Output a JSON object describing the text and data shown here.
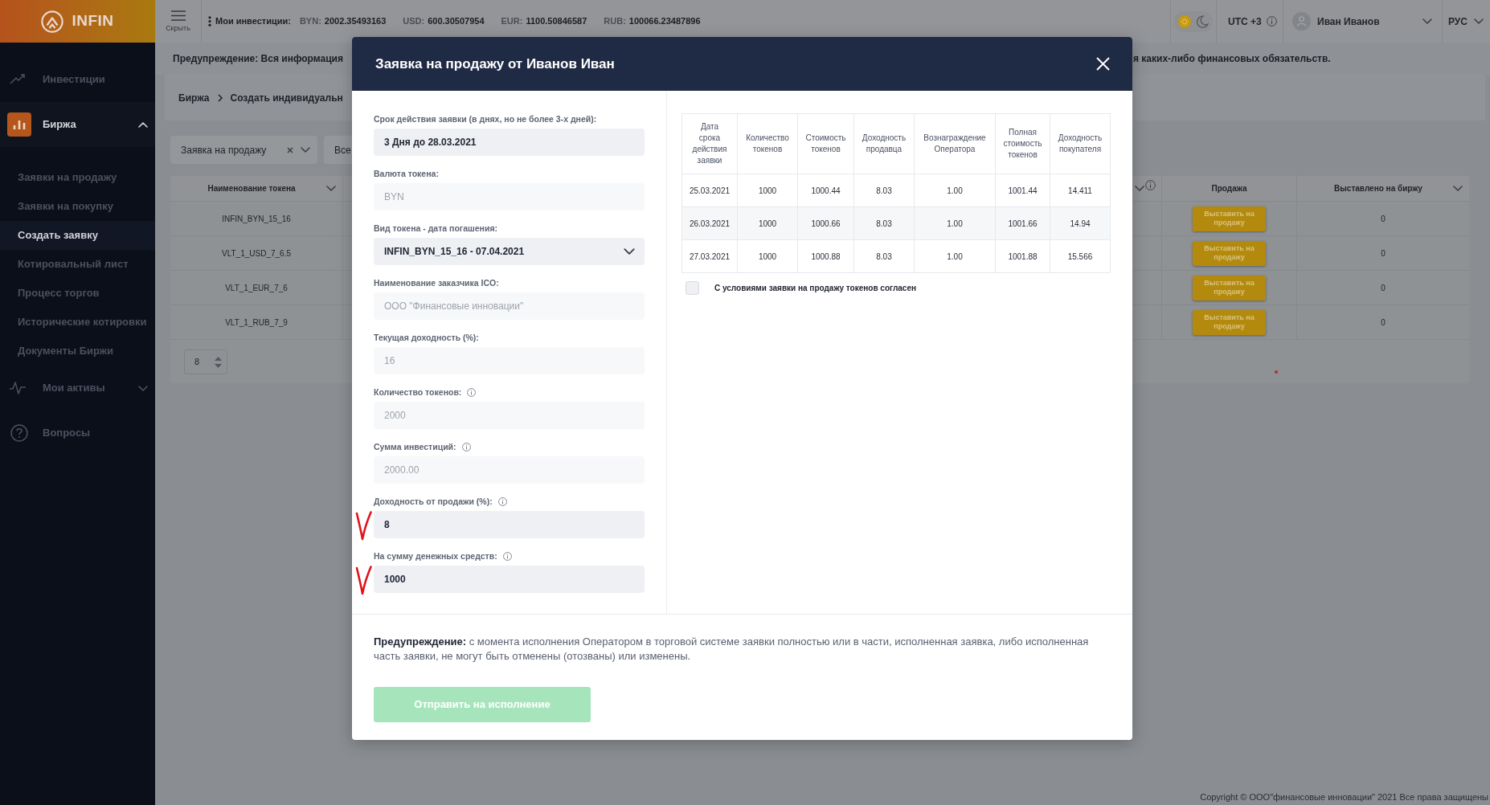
{
  "topbar": {
    "logo": "INFIN",
    "hide_label": "Скрыть",
    "investments_label": "Мои инвестиции:",
    "balances": [
      {
        "currency": "BYN:",
        "amount": "2002.35493163"
      },
      {
        "currency": "USD:",
        "amount": "600.30507954"
      },
      {
        "currency": "EUR:",
        "amount": "1100.50846587"
      },
      {
        "currency": "RUB:",
        "amount": "100066.23487896"
      }
    ],
    "dark_mode": false,
    "timezone": "UTC +3",
    "user": "Иван Иванов",
    "language": "РУС"
  },
  "sidebar": {
    "items": [
      {
        "label": "Инвестиции",
        "selected": false
      },
      {
        "label": "Биржа",
        "selected": true,
        "expanded": true,
        "children": [
          {
            "label": "Заявки на продажу",
            "selected": false
          },
          {
            "label": "Заявки на покупку",
            "selected": false
          },
          {
            "label": "Создать заявку",
            "selected": true
          },
          {
            "label": "Котировальный лист",
            "selected": false
          },
          {
            "label": "Процесс торгов",
            "selected": false
          },
          {
            "label": "Исторические котировки",
            "selected": false
          },
          {
            "label": "Документы Биржи",
            "selected": false
          }
        ]
      },
      {
        "label": "Мои активы",
        "selected": false,
        "expanded": false
      },
      {
        "label": "Вопросы",
        "selected": false
      }
    ]
  },
  "notice": {
    "text_start": "Предупреждение: Вся информация",
    "text_end": "я каких-либо финансовых обязательств."
  },
  "breadcrumb": [
    "Биржа",
    "Создать индивидуальн"
  ],
  "filters": [
    {
      "value": "Заявка на продажу",
      "clearable": true
    },
    {
      "value": "Все",
      "clearable": false
    }
  ],
  "table": {
    "columns": [
      {
        "label": "Наименование токена",
        "sortable": true,
        "info": false
      },
      {
        "sortable": true,
        "info": true
      },
      {
        "label": "Продажа",
        "sortable": false,
        "info": false
      },
      {
        "label": "Выставлено на биржу",
        "sortable": true,
        "info": false
      }
    ],
    "rows": [
      {
        "token": "INFIN_BYN_15_16",
        "action": "Выставить на продажу",
        "listed": "0"
      },
      {
        "token": "VLT_1_USD_7_6.5",
        "action": "Выставить на продажу",
        "listed": "0"
      },
      {
        "token": "VLT_1_EUR_7_6",
        "action": "Выставить на продажу",
        "listed": "0"
      },
      {
        "token": "VLT_1_RUB_7_9",
        "action": "Выставить на продажу",
        "listed": "0"
      }
    ],
    "page_size": "8"
  },
  "modal": {
    "title": "Заявка на продажу от Иванов Иван",
    "fields": [
      {
        "label": "Срок действия заявки (в днях, но не более 3-х дней):",
        "value": "3 Дня до 28.03.2021",
        "kind": "input",
        "disabled": false,
        "info": false,
        "marked": false
      },
      {
        "label": "Валюта токена:",
        "value": "BYN",
        "kind": "input",
        "disabled": true,
        "info": false,
        "marked": false
      },
      {
        "label": "Вид токена - дата погашения:",
        "value": "INFIN_BYN_15_16 - 07.04.2021",
        "kind": "select",
        "disabled": false,
        "info": false,
        "marked": false
      },
      {
        "label": "Наименование заказчика ICO:",
        "value": "ООО \"Финансовые инновации\"",
        "kind": "input",
        "disabled": true,
        "info": false,
        "marked": false
      },
      {
        "label": "Текущая доходность (%):",
        "value": "16",
        "kind": "input",
        "disabled": true,
        "info": false,
        "marked": false
      },
      {
        "label": "Количество токенов:",
        "value": "2000",
        "kind": "input",
        "disabled": true,
        "info": true,
        "marked": false
      },
      {
        "label": "Сумма инвестиций:",
        "value": "2000.00",
        "kind": "input",
        "disabled": true,
        "info": true,
        "marked": false
      },
      {
        "label": "Доходность от продажи (%):",
        "value": "8",
        "kind": "input",
        "disabled": false,
        "info": true,
        "marked": true
      },
      {
        "label": "На сумму денежных средств:",
        "value": "1000",
        "kind": "input",
        "disabled": false,
        "info": true,
        "marked": true
      }
    ],
    "schedule": {
      "columns": [
        "Дата срока действия заявки",
        "Количество токенов",
        "Стоимость токенов",
        "Доходность продавца",
        "Вознаграждение Оператора",
        "Полная стоимость токенов",
        "Доходность покупателя"
      ],
      "rows": [
        [
          "25.03.2021",
          "1000",
          "1000.44",
          "8.03",
          "1.00",
          "1001.44",
          "14.411"
        ],
        [
          "26.03.2021",
          "1000",
          "1000.66",
          "8.03",
          "1.00",
          "1001.66",
          "14.94"
        ],
        [
          "27.03.2021",
          "1000",
          "1000.88",
          "8.03",
          "1.00",
          "1001.88",
          "15.566"
        ]
      ]
    },
    "agreement": {
      "label": "С условиями заявки на продажу токенов согласен",
      "checked": false
    },
    "warning": "**Предупреждение:** с момента исполнения Оператором в торговой системе заявки полностью или в части, исполненная заявка, либо исполненная часть заявки, не могут быть отменены (отозваны) или изменены.",
    "submit": {
      "label": "Отправить на исполнение",
      "disabled": true
    }
  },
  "footer": "Copyright © ООО\"финансовые инновации\" 2021 Все права защищены"
}
